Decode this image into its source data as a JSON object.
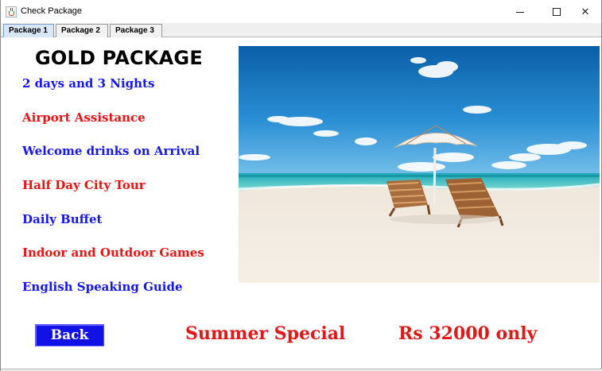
{
  "window": {
    "title": "Check Package",
    "icon": "java-cup-icon"
  },
  "tabs": [
    {
      "label": "Package 1",
      "active": true
    },
    {
      "label": "Package 2",
      "active": false
    },
    {
      "label": "Package 3",
      "active": false
    }
  ],
  "package": {
    "title": "GOLD PACKAGE",
    "features": [
      {
        "label": "2 days and 3 Nights",
        "color": "#1414ff"
      },
      {
        "label": "Airport Assistance",
        "color": "#f01010"
      },
      {
        "label": "Welcome drinks on Arrival",
        "color": "#1414ff"
      },
      {
        "label": "Half Day City Tour",
        "color": "#f01010"
      },
      {
        "label": "Daily Buffet",
        "color": "#1414ff"
      },
      {
        "label": "Indoor and Outdoor Games",
        "color": "#f01010"
      },
      {
        "label": "English Speaking Guide",
        "color": "#1414ff"
      }
    ]
  },
  "footer": {
    "back_label": "Back",
    "promo_label": "Summer Special",
    "price_label": "Rs 32000 only"
  },
  "colors": {
    "accent_blue": "#1414ff",
    "accent_red": "#f01010",
    "button_bg": "#1212e6"
  }
}
